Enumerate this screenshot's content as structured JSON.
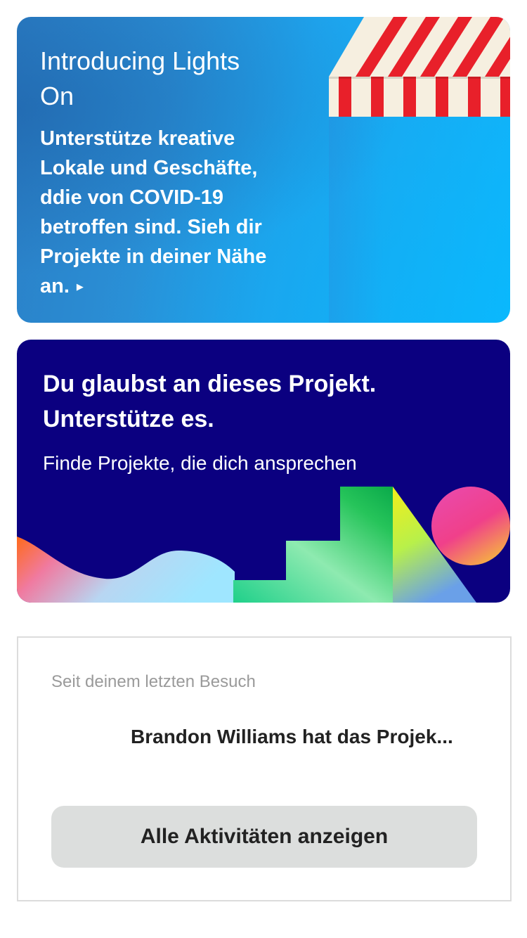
{
  "promo_lights_on": {
    "title": "Introducing Lights On",
    "body": "Unterstütze kreative Lokale und Geschäfte, ddie von COVID-19 betroffen sind. Sieh dir Projekte in deiner Nähe an.",
    "arrow_icon": "play-triangle-icon",
    "background_color": "#1ea3ec",
    "awning_colors": [
      "#e8202a",
      "#f6efe0"
    ]
  },
  "promo_support": {
    "title": "Du glaubst an dieses Projekt. Unterstütze es.",
    "subtitle": "Finde Projekte, die dich ansprechen",
    "background_color": "#0b0080"
  },
  "activity": {
    "heading": "Seit deinem letzten Besuch",
    "items": [
      {
        "text": "Brandon Williams hat das Projek..."
      }
    ],
    "show_all_label": "Alle Aktivitäten anzeigen"
  }
}
